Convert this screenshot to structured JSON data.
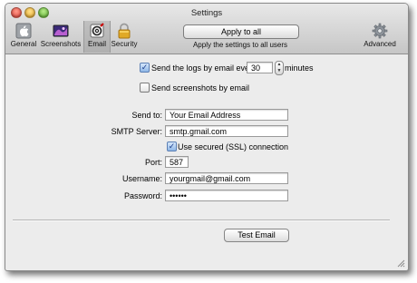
{
  "window": {
    "title": "Settings"
  },
  "toolbar": {
    "items": [
      {
        "label": "General",
        "icon": "apple-icon"
      },
      {
        "label": "Screenshots",
        "icon": "screenshots-icon"
      },
      {
        "label": "Email",
        "icon": "email-icon"
      },
      {
        "label": "Security",
        "icon": "padlock-icon"
      },
      {
        "label": "Advanced",
        "icon": "gear-icon"
      }
    ],
    "selected": "Email",
    "apply_label": "Apply to all",
    "apply_caption": "Apply the settings to all users"
  },
  "logs": {
    "checked": true,
    "label_before": "Send the logs by email every",
    "interval": "30",
    "label_after": "minutes"
  },
  "screenshots": {
    "checked": false,
    "label": "Send screenshots by email"
  },
  "form": {
    "send_to_label": "Send to:",
    "send_to_value": "Your Email Address",
    "smtp_label": "SMTP Server:",
    "smtp_value": "smtp.gmail.com",
    "ssl_checked": true,
    "ssl_label": "Use secured (SSL) connection",
    "port_label": "Port:",
    "port_value": "587",
    "username_label": "Username:",
    "username_value": "yourgmail@gmail.com",
    "password_label": "Password:",
    "password_value": "••••••"
  },
  "test_button": "Test Email",
  "colors": {
    "accent": "#5b7fb4",
    "window_bg": "#ececec"
  }
}
